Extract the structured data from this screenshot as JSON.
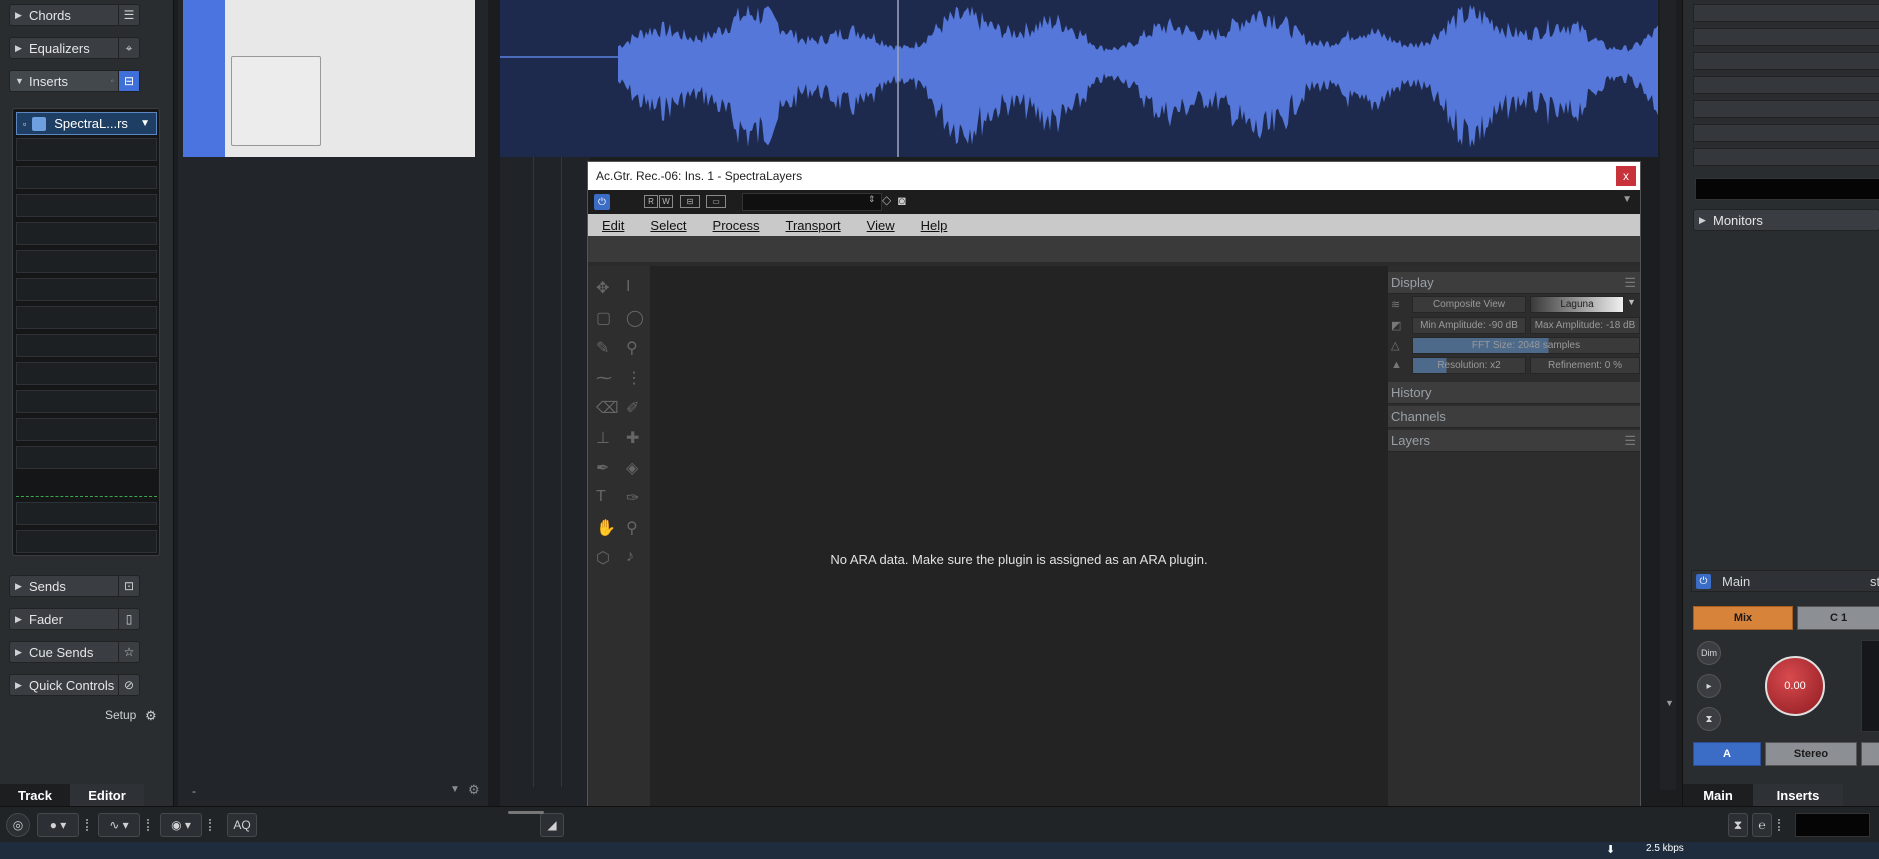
{
  "inspector": {
    "sections_top": [
      {
        "label": "Chords",
        "icon": "sliders-icon"
      },
      {
        "label": "Equalizers",
        "icon": "eq-icon"
      },
      {
        "label": "Inserts",
        "icon": "insert-icon"
      }
    ],
    "insert_plugin": "SpectraL...rs",
    "sections_bottom": [
      {
        "label": "Sends",
        "icon": "send-icon"
      },
      {
        "label": "Fader",
        "icon": "fader-icon"
      },
      {
        "label": "Cue Sends",
        "icon": "star-icon"
      },
      {
        "label": "Quick Controls",
        "icon": "circle-slash-icon"
      }
    ],
    "setup_label": "Setup",
    "tabs": [
      "Track",
      "Editor"
    ]
  },
  "center": {
    "dash": "-"
  },
  "plugin": {
    "title": "Ac.Gtr. Rec.-06: Ins. 1 - SpectraLayers",
    "close": "x",
    "menu": [
      "Edit",
      "Select",
      "Process",
      "Transport",
      "View",
      "Help"
    ],
    "message": "No ARA data. Make sure the plugin is assigned as an ARA plugin.",
    "panel": {
      "display_label": "Display",
      "composite_view": "Composite View",
      "colormap": "Laguna",
      "min_amplitude": "Min Amplitude: -90 dB",
      "max_amplitude": "Max Amplitude: -18 dB",
      "fft_size": "FFT Size: 2048 samples",
      "resolution": "Resolution: x2",
      "refinement": "Refinement: 0 %",
      "history_label": "History",
      "channels_label": "Channels",
      "layers_label": "Layers"
    }
  },
  "mixer": {
    "monitors_label": "Monitors",
    "main_label": "Main",
    "main_right": "ste",
    "mix_label": "Mix",
    "c1_label": "C 1",
    "dim_label": "Dim",
    "knob_value": "0.00",
    "a_label": "A",
    "stereo_label": "Stereo",
    "tabs": [
      "Main",
      "Inserts"
    ]
  },
  "bottombar": {
    "aq_label": "AQ"
  },
  "taskbar": {
    "rate": "2.5 kbps"
  },
  "colors": {
    "accent_blue": "#4c74e0",
    "mix_orange": "#d8833a",
    "knob_red": "#b3262c"
  }
}
